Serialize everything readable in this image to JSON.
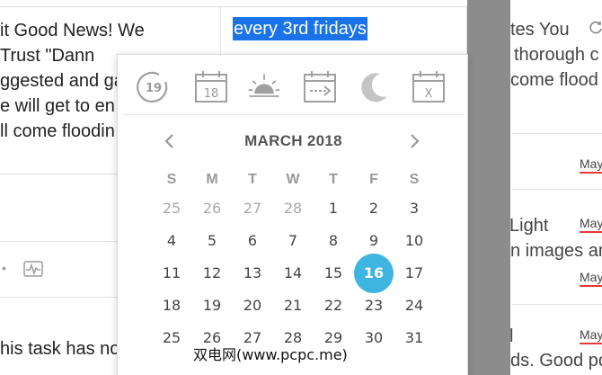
{
  "task_card": {
    "note_lines": [
      "it Good News! We",
      "Trust \"Dann",
      "ggested and ga",
      "e will get to en",
      "ll come floodin"
    ],
    "selected_text": "every 3rd fridays",
    "status_text": "his task has no",
    "dot": "•"
  },
  "right_panel": {
    "texts": [
      "tes You",
      "thorough c",
      "come flood",
      "Light",
      "n images and",
      "l",
      "ds. Good po"
    ],
    "tags": [
      "May",
      "May",
      "May",
      "May"
    ]
  },
  "date_picker": {
    "quick_options": [
      {
        "name": "today",
        "label": "19"
      },
      {
        "name": "tomorrow",
        "label": "18"
      },
      {
        "name": "this-weekend",
        "label": ""
      },
      {
        "name": "next-week",
        "label": ""
      },
      {
        "name": "evening",
        "label": ""
      },
      {
        "name": "no-date",
        "label": "X"
      }
    ],
    "month_title": "MARCH 2018",
    "weekdays": [
      "S",
      "M",
      "T",
      "W",
      "T",
      "F",
      "S"
    ],
    "weeks": [
      [
        {
          "d": "25",
          "o": true
        },
        {
          "d": "26",
          "o": true
        },
        {
          "d": "27",
          "o": true
        },
        {
          "d": "28",
          "o": true
        },
        {
          "d": "1"
        },
        {
          "d": "2"
        },
        {
          "d": "3"
        }
      ],
      [
        {
          "d": "4"
        },
        {
          "d": "5"
        },
        {
          "d": "6"
        },
        {
          "d": "7"
        },
        {
          "d": "8"
        },
        {
          "d": "9"
        },
        {
          "d": "10"
        }
      ],
      [
        {
          "d": "11"
        },
        {
          "d": "12"
        },
        {
          "d": "13"
        },
        {
          "d": "14"
        },
        {
          "d": "15"
        },
        {
          "d": "16",
          "s": true
        },
        {
          "d": "17"
        }
      ],
      [
        {
          "d": "18"
        },
        {
          "d": "19"
        },
        {
          "d": "20"
        },
        {
          "d": "21"
        },
        {
          "d": "22"
        },
        {
          "d": "23"
        },
        {
          "d": "24"
        }
      ],
      [
        {
          "d": "25"
        },
        {
          "d": "26"
        },
        {
          "d": "27"
        },
        {
          "d": "28"
        },
        {
          "d": "29"
        },
        {
          "d": "30"
        },
        {
          "d": "31"
        }
      ]
    ],
    "accent_color": "#3eb5e0"
  },
  "watermark": "双电网(www.pcpc.me)"
}
